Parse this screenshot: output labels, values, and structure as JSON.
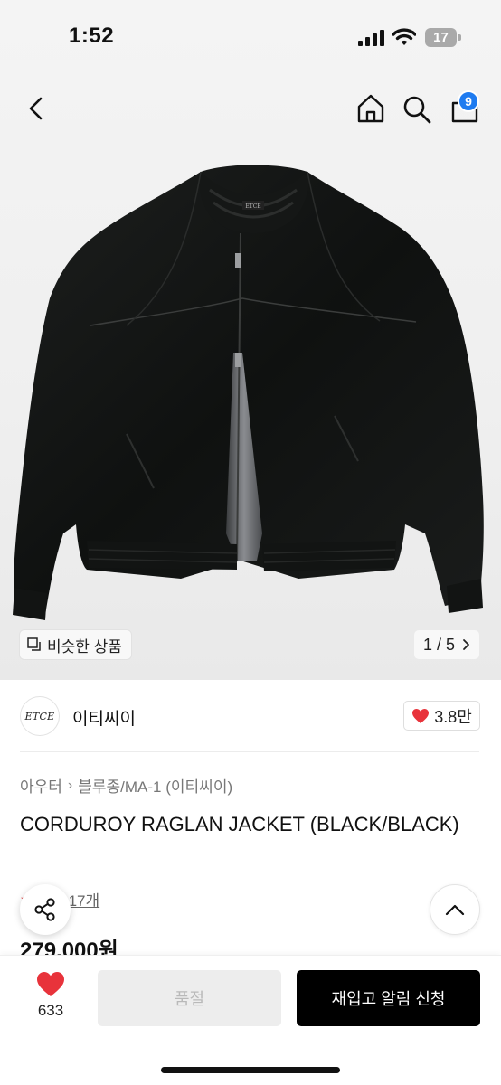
{
  "status_bar": {
    "time": "1:52",
    "battery": "17"
  },
  "nav": {
    "cart_count": "9"
  },
  "gallery": {
    "logo_text": "ETCE",
    "similar_label": "비슷한 상품",
    "counter": "1 / 5"
  },
  "brand": {
    "logo_text": "ETCE",
    "name": "이티씨이",
    "likes": "3.8만"
  },
  "breadcrumb": {
    "category": "아우터",
    "subcategory": "블루종/MA-1 (이티씨이)"
  },
  "product": {
    "title": "CORDUROY RAGLAN JACKET (BLACK/BLACK)",
    "review_label": "후기 17개",
    "price": "279,000원"
  },
  "bottom_bar": {
    "wish_count": "633",
    "soldout_label": "품절",
    "restock_label": "재입고 알림 신청"
  },
  "colors": {
    "accent_blue": "#1e7bf0",
    "heart_red": "#e8333b",
    "primary_button": "#000000",
    "disabled_button": "#ededed"
  }
}
